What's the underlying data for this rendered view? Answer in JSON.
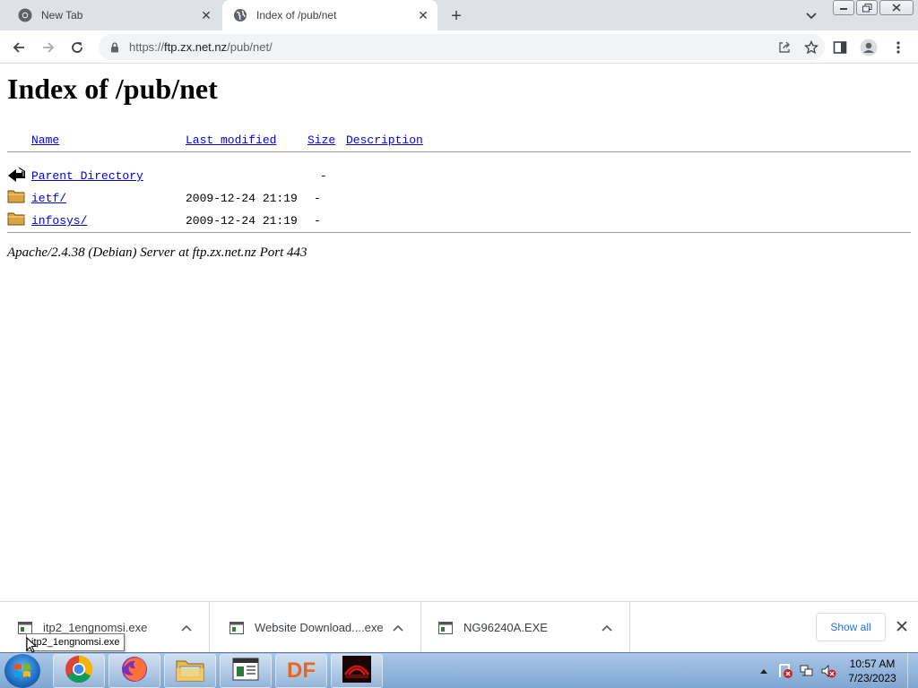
{
  "tabs": [
    {
      "title": "New Tab",
      "favicon": "chrome-icon",
      "active": false
    },
    {
      "title": "Index of /pub/net",
      "favicon": "globe-icon",
      "active": true
    }
  ],
  "omnibox": {
    "scheme": "https://",
    "host": "ftp.zx.net.nz",
    "path": "/pub/net/"
  },
  "page": {
    "heading": "Index of /pub/net",
    "columns": {
      "name": "Name",
      "modified": "Last modified",
      "size": "Size",
      "description": "Description"
    },
    "rows": [
      {
        "icon": "back-arrow-icon",
        "name": "Parent Directory",
        "modified": "",
        "size": "-"
      },
      {
        "icon": "folder-icon",
        "name": "ietf/",
        "modified": "2009-12-24 21:19",
        "size": "-"
      },
      {
        "icon": "folder-icon",
        "name": "infosys/",
        "modified": "2009-12-24 21:19",
        "size": "-"
      }
    ],
    "address": "Apache/2.4.38 (Debian) Server at ftp.zx.net.nz Port 443"
  },
  "downloads": {
    "items": [
      {
        "name": "itp2_1engnomsi.exe"
      },
      {
        "name": "Website Download....exe"
      },
      {
        "name": "NG96240A.EXE"
      }
    ],
    "show_all": "Show all",
    "tooltip": "itp2_1engnomsi.exe"
  },
  "taskbar": {
    "apps": [
      "chrome-icon",
      "firefox-icon",
      "file-explorer-icon",
      "app-window-icon",
      "df-icon",
      "red-app-icon"
    ],
    "df_label": "DF",
    "time": "10:57 AM",
    "date": "7/23/2023"
  }
}
